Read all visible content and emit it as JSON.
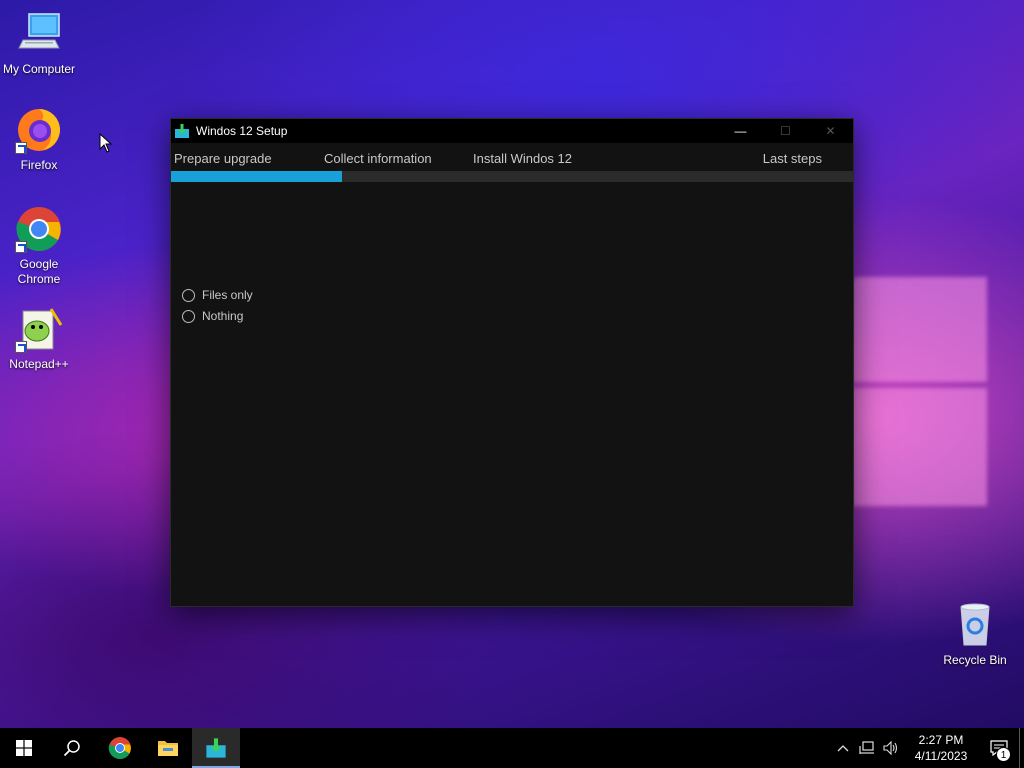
{
  "desktop": {
    "icons": [
      {
        "label": "My Computer",
        "icon": "computer-icon"
      },
      {
        "label": "Firefox",
        "icon": "firefox-icon"
      },
      {
        "label": "Google Chrome",
        "icon": "chrome-icon"
      },
      {
        "label": "Notepad++",
        "icon": "notepadpp-icon"
      },
      {
        "label": "Recycle Bin",
        "icon": "recycle-bin-icon"
      }
    ]
  },
  "window": {
    "title": "Windos 12 Setup",
    "controls": {
      "minimize": "—",
      "maximize": "☐",
      "close": "✕"
    },
    "steps": [
      {
        "label": "Prepare upgrade"
      },
      {
        "label": "Collect information"
      },
      {
        "label": "Install Windos 12"
      },
      {
        "label": "Last steps"
      }
    ],
    "progress_fraction": 0.25,
    "accent_color": "#1aa0d8",
    "options": [
      {
        "label": "Files only",
        "selected": false
      },
      {
        "label": "Nothing",
        "selected": false
      }
    ]
  },
  "taskbar": {
    "buttons": [
      "start-icon",
      "search-icon",
      "chrome-icon",
      "file-explorer-icon",
      "setup-icon"
    ],
    "clock": {
      "time": "2:27 PM",
      "date": "4/11/2023"
    },
    "notification_count": "1"
  }
}
